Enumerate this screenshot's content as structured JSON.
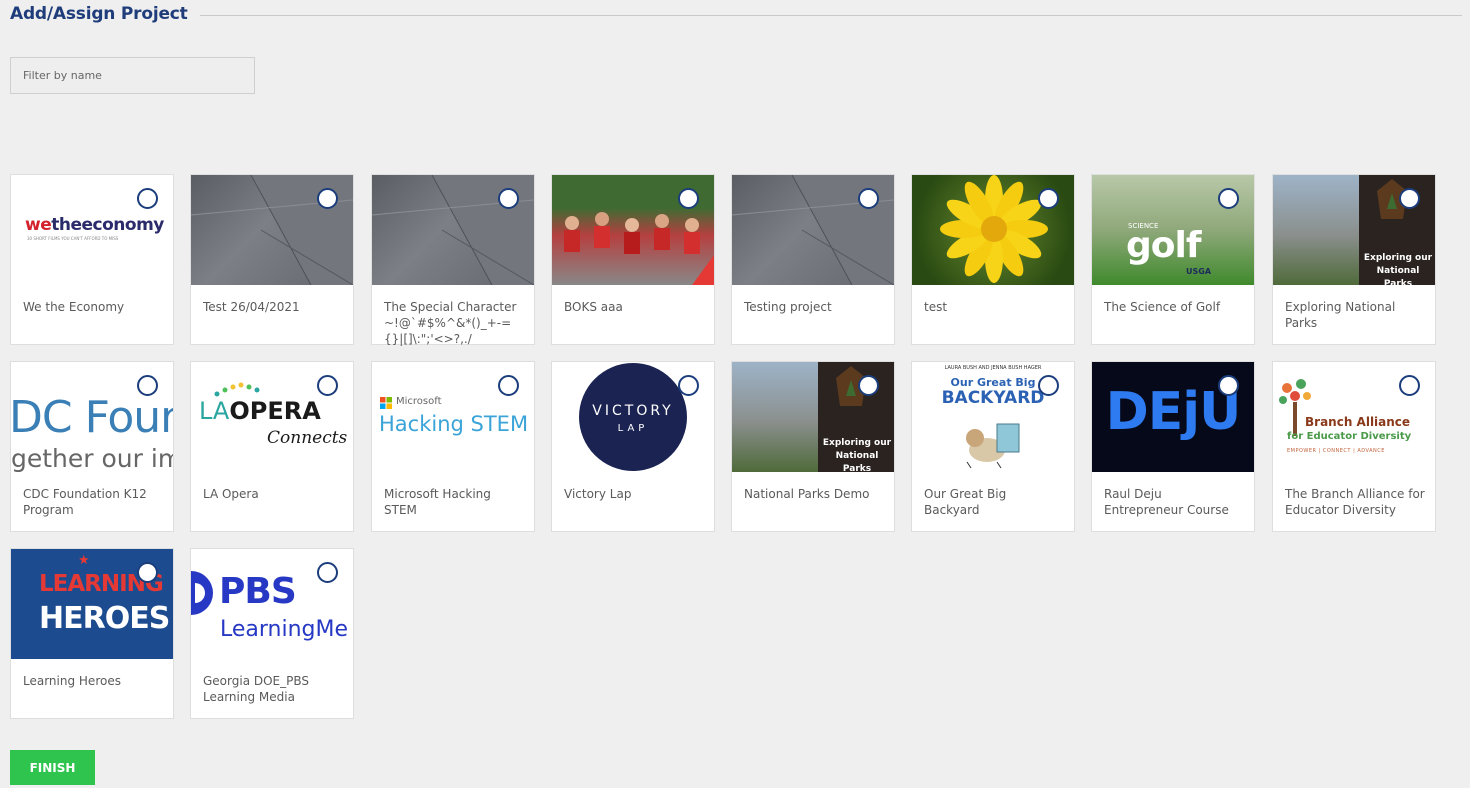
{
  "header": {
    "title": "Add/Assign Project"
  },
  "filter": {
    "placeholder": "Filter by name"
  },
  "thumb_text": {
    "wte_main": "wetheeconomy",
    "wte_we": "we",
    "wte_the": "the",
    "wte_eco": "economy",
    "wte_sub": "30 SHORT FILMS YOU CAN'T AFFORD TO MISS",
    "golf_science": "SCIENCE",
    "golf_word": "golf",
    "golf_usga": "USGA",
    "parks_title": "Exploring our National Parks",
    "cdc_big": "DC Foun",
    "cdc_small": "gether our imp",
    "laopera_la": "LA",
    "laopera_opera": "OPERA",
    "laopera_connects": "Connects",
    "ms_name": "Microsoft",
    "ms_stem": "Hacking STEM",
    "victory_1": "VICTORY",
    "victory_2": "LAP",
    "backyard_top": "LAURA BUSH AND JENNA BUSH HAGER",
    "backyard_1": "Our Great Big",
    "backyard_2": "BACKYARD",
    "deju": "DEjU",
    "branch_1": "Branch Alliance",
    "branch_2": "for Educator Diversity",
    "branch_3": "EMPOWER | CONNECT | ADVANCE",
    "heroes_1": "LEARNING",
    "heroes_2": "HEROES",
    "pbs_1": "PBS",
    "pbs_2": "LearningMe"
  },
  "projects": [
    {
      "name": "We the Economy"
    },
    {
      "name": "Test 26/04/2021"
    },
    {
      "name": "The Special Character ~!@`#$%^&*()_+-={}|[]\\:\";'<>?,./"
    },
    {
      "name": "BOKS aaa"
    },
    {
      "name": "Testing project"
    },
    {
      "name": "test"
    },
    {
      "name": "The Science of Golf"
    },
    {
      "name": "Exploring National Parks"
    },
    {
      "name": "CDC Foundation K12 Program"
    },
    {
      "name": "LA Opera"
    },
    {
      "name": "Microsoft Hacking STEM"
    },
    {
      "name": "Victory Lap"
    },
    {
      "name": "National Parks Demo"
    },
    {
      "name": "Our Great Big Backyard"
    },
    {
      "name": "Raul Deju Entrepreneur Course"
    },
    {
      "name": "The Branch Alliance for Educator Diversity"
    },
    {
      "name": "Learning Heroes"
    },
    {
      "name": "Georgia DOE_PBS Learning Media"
    }
  ],
  "footer": {
    "finish_label": "FINISH"
  },
  "colors": {
    "title": "#1f3d7a",
    "radio_border": "#1b3d7c",
    "finish_bg": "#2ec44e",
    "background": "#efefef"
  }
}
